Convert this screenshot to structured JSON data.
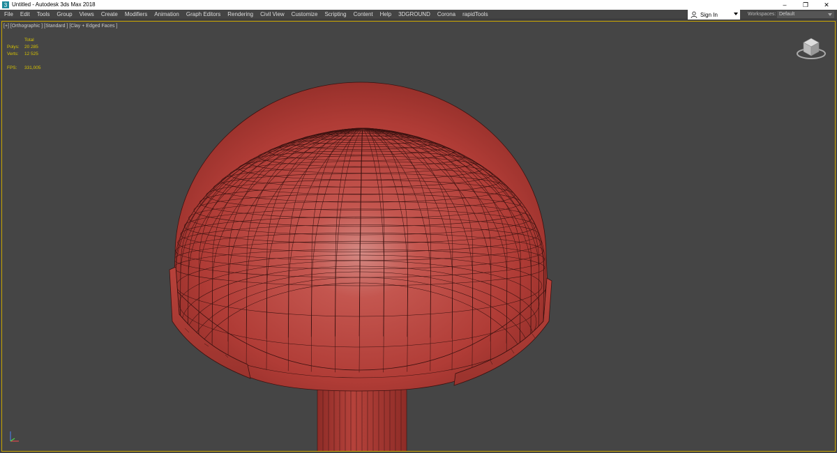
{
  "window": {
    "title": "Untitled - Autodesk 3ds Max 2018",
    "controls": {
      "minimize": "–",
      "restore": "❐",
      "close": "✕"
    }
  },
  "menubar": {
    "items": [
      "File",
      "Edit",
      "Tools",
      "Group",
      "Views",
      "Create",
      "Modifiers",
      "Animation",
      "Graph Editors",
      "Rendering",
      "Civil View",
      "Customize",
      "Scripting",
      "Content",
      "Help",
      "3DGROUND",
      "Corona",
      "rapidTools"
    ],
    "signin_label": "Sign In",
    "workspaces_label": "Workspaces:",
    "workspaces_value": "Default"
  },
  "viewport": {
    "label": "[+] [Orthographic ] [Standard ] [Clay + Edged Faces ]",
    "stats": {
      "header": "Total",
      "polys_label": "Polys:",
      "polys_value": "20 285",
      "verts_label": "Verts:",
      "verts_value": "12 525",
      "fps_label": "FPS:",
      "fps_value": "331,005"
    }
  },
  "colors": {
    "viewport_bg": "#454545",
    "active_border": "#c9a600",
    "stats_text": "#d8c300",
    "clay": "#b8403a"
  }
}
